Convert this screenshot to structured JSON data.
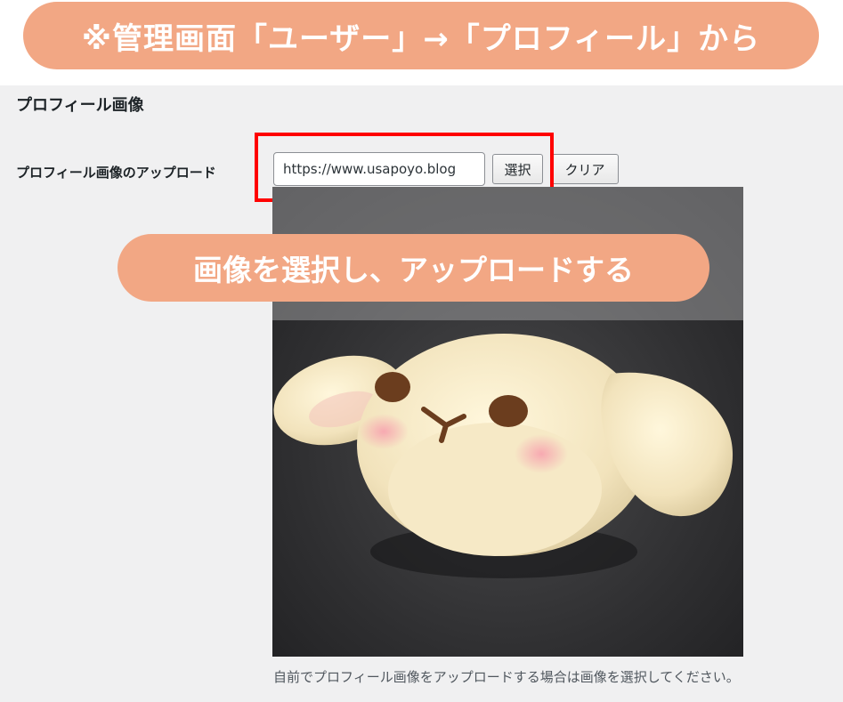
{
  "annotations": {
    "top_banner": "※管理画面「ユーザー」→「プロフィール」から",
    "middle_banner": "画像を選択し、アップロードする",
    "accent_color": "#f2a784",
    "highlight_color": "#ff0000"
  },
  "profile_section": {
    "title": "プロフィール画像",
    "upload_label": "プロフィール画像のアップロード",
    "url_value": "https://www.usapoyo.blog",
    "select_button": "選択",
    "clear_button": "クリア",
    "description": "自前でプロフィール画像をアップロードする場合は画像を選択してください。"
  }
}
